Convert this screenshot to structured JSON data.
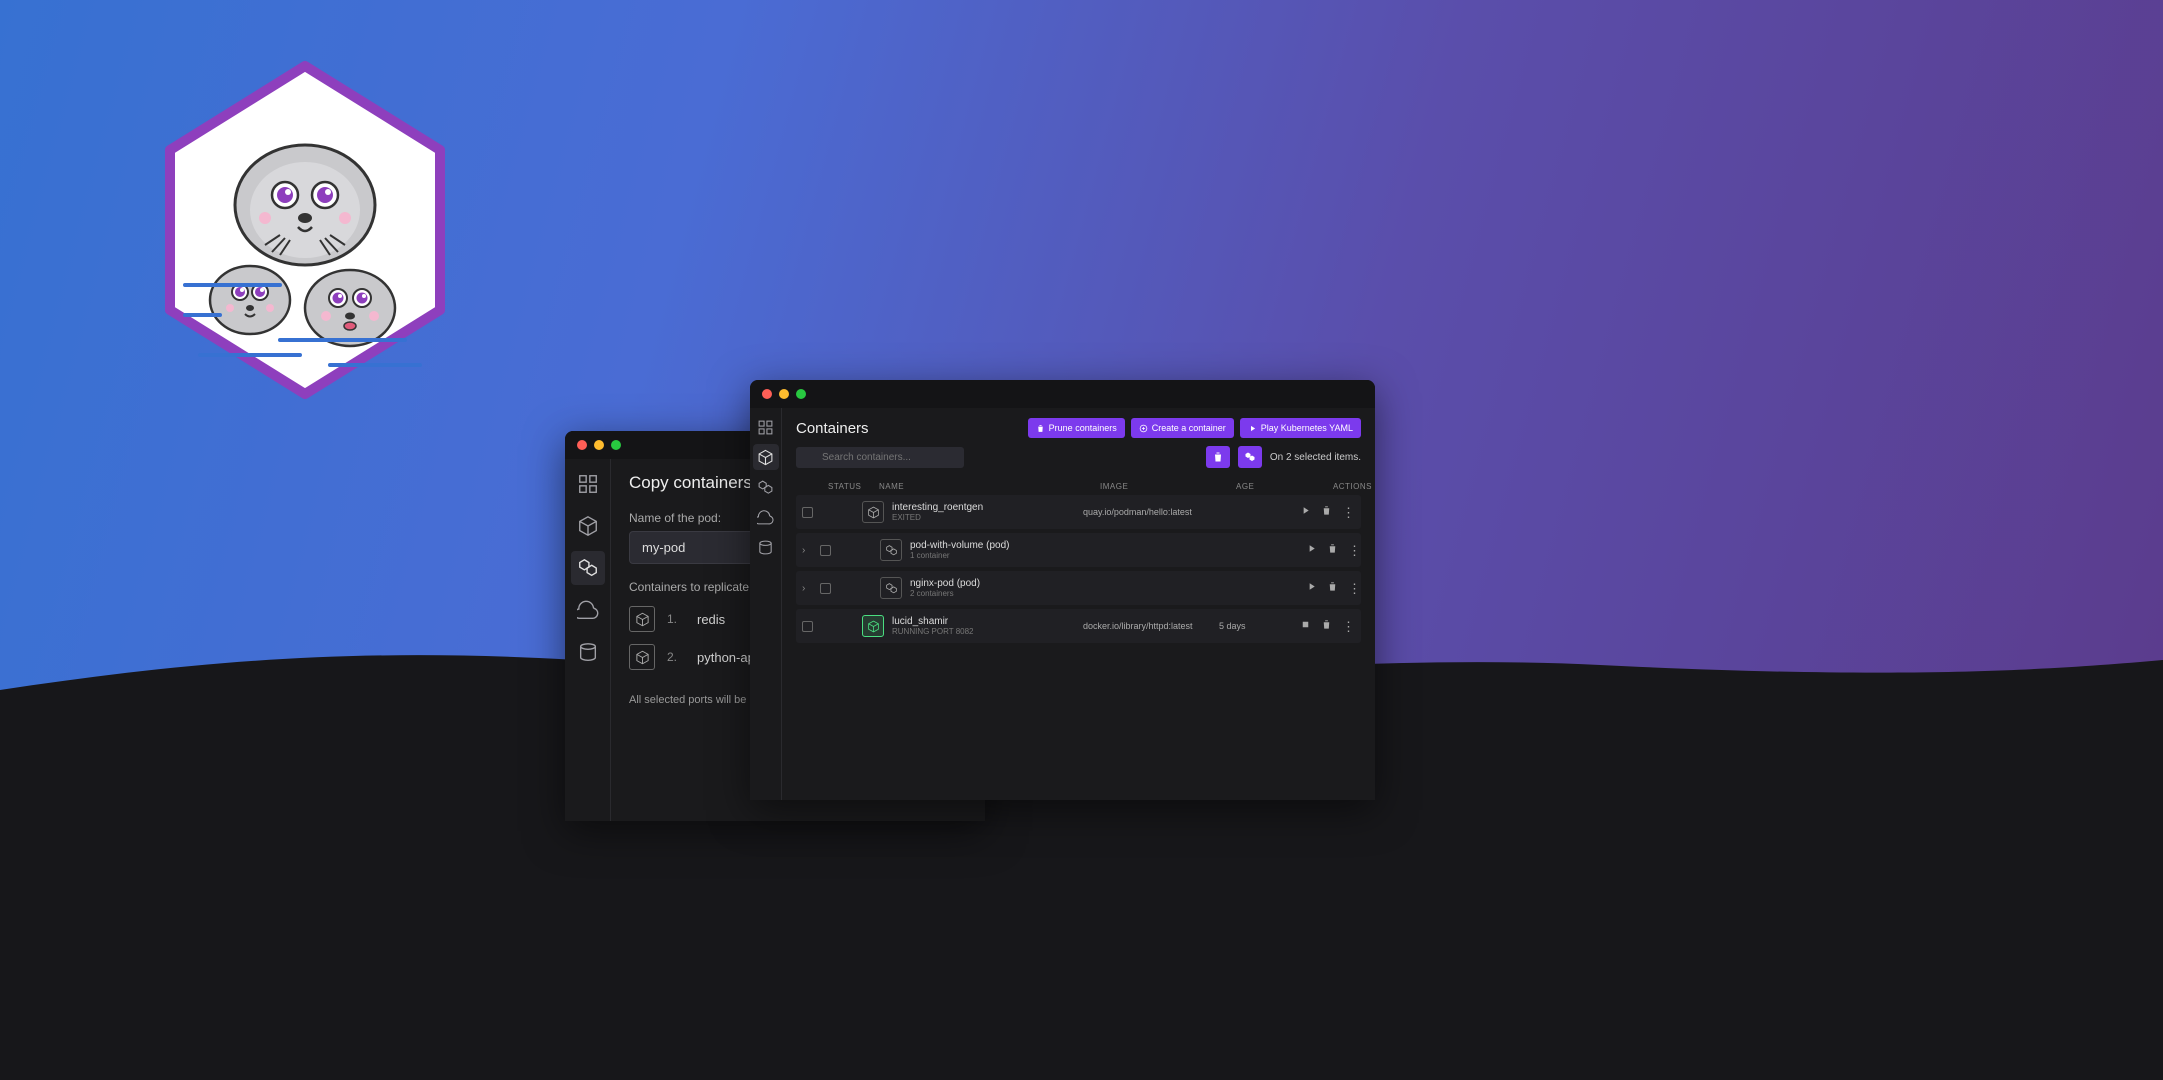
{
  "backWindow": {
    "title": "Copy containers to a pod",
    "podNameLabel": "Name of the pod:",
    "podNameValue": "my-pod",
    "replicateLabel": "Containers to replicate to the pod:",
    "containers": [
      {
        "index": "1.",
        "name": "redis"
      },
      {
        "index": "2.",
        "name": "python-app"
      }
    ],
    "footnote": "All selected ports will be exposed"
  },
  "frontWindow": {
    "title": "Containers",
    "buttons": {
      "prune": "Prune containers",
      "create": "Create a container",
      "play": "Play Kubernetes YAML"
    },
    "searchPlaceholder": "Search containers...",
    "selectionInfo": "On 2 selected items.",
    "columns": {
      "status": "STATUS",
      "name": "NAME",
      "image": "IMAGE",
      "age": "AGE",
      "actions": "ACTIONS"
    },
    "rows": [
      {
        "type": "container",
        "name": "interesting_roentgen",
        "sub": "EXITED",
        "image": "quay.io/podman/hello:latest",
        "age": "",
        "running": false,
        "checked": false
      },
      {
        "type": "pod",
        "name": "pod-with-volume (pod)",
        "sub": "1 container",
        "image": "",
        "age": "",
        "running": false,
        "checked": false
      },
      {
        "type": "pod",
        "name": "nginx-pod (pod)",
        "sub": "2 containers",
        "image": "",
        "age": "",
        "running": false,
        "checked": false
      },
      {
        "type": "container",
        "name": "lucid_shamir",
        "sub": "RUNNING  PORT 8082",
        "image": "docker.io/library/httpd:latest",
        "age": "5 days",
        "running": true,
        "checked": false
      }
    ]
  }
}
